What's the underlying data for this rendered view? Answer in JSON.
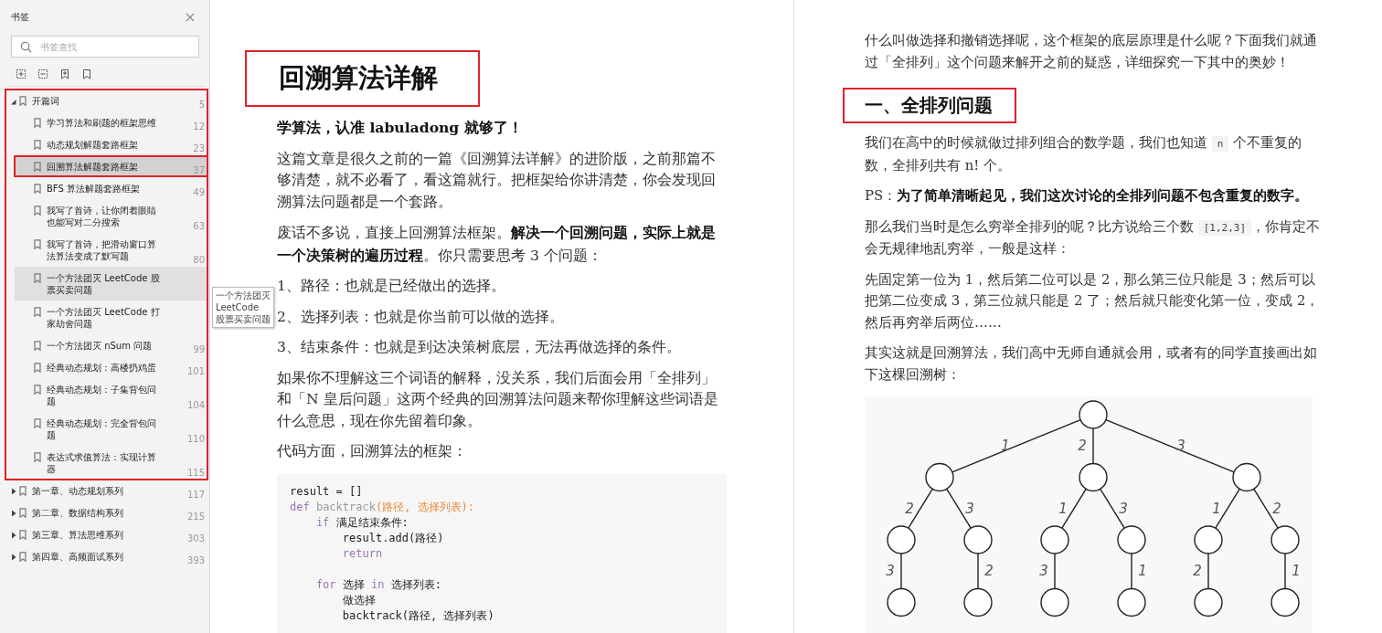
{
  "sidebar": {
    "title": "书签",
    "search": {
      "placeholder": "书签查找"
    },
    "items": [
      {
        "label": "开篇词",
        "page": "5",
        "expanded": true,
        "selected": false,
        "hovered": false,
        "annotated": true,
        "children": [
          {
            "label": "学习算法和刷题的框架思维",
            "page": "12",
            "selected": false,
            "hovered": false,
            "annotated": false
          },
          {
            "label": "动态规划解题套路框架",
            "page": "23",
            "selected": false,
            "hovered": false,
            "annotated": false
          },
          {
            "label": "回溯算法解题套路框架",
            "page": "37",
            "selected": true,
            "hovered": false,
            "annotated": true
          },
          {
            "label": "BFS 算法解题套路框架",
            "page": "49",
            "selected": false,
            "hovered": false,
            "annotated": false
          },
          {
            "label": "我写了首诗，让你闭着眼睛也能写对二分搜索",
            "page": "63",
            "selected": false,
            "hovered": false,
            "annotated": false
          },
          {
            "label": "我写了首诗，把滑动窗口算法算法变成了默写题",
            "page": "80",
            "selected": false,
            "hovered": false,
            "annotated": false
          },
          {
            "label": "一个方法团灭 LeetCode 股票买卖问题",
            "selected": false,
            "hovered": true,
            "annotated": false,
            "tooltip": "一个方法团灭 LeetCode 股票买卖问题"
          },
          {
            "label": "一个方法团灭 LeetCode 打家劫舍问题",
            "selected": false,
            "hovered": false,
            "annotated": false
          },
          {
            "label": "一个方法团灭 nSum 问题",
            "page": "99",
            "selected": false,
            "hovered": false,
            "annotated": false
          },
          {
            "label": "经典动态规划：高楼扔鸡蛋",
            "page": "101",
            "selected": false,
            "hovered": false,
            "annotated": false
          },
          {
            "label": "经典动态规划：子集背包问题",
            "page": "104",
            "selected": false,
            "hovered": false,
            "annotated": false
          },
          {
            "label": "经典动态规划：完全背包问题",
            "page": "110",
            "selected": false,
            "hovered": false,
            "annotated": false
          },
          {
            "label": "表达式求值算法：实现计算器",
            "page": "115",
            "selected": false,
            "hovered": false,
            "annotated": false
          }
        ]
      },
      {
        "label": "第一章、动态规划系列",
        "page": "117",
        "expanded": false,
        "selected": false,
        "hovered": false,
        "annotated": false
      },
      {
        "label": "第二章、数据结构系列",
        "page": "215",
        "expanded": false,
        "selected": false,
        "hovered": false,
        "annotated": false
      },
      {
        "label": "第三章、算法思维系列",
        "page": "303",
        "expanded": false,
        "selected": false,
        "hovered": false,
        "annotated": false
      },
      {
        "label": "第四章、高频面试系列",
        "page": "393",
        "expanded": false,
        "selected": false,
        "hovered": false,
        "annotated": false
      }
    ]
  },
  "pages": [
    {
      "blocks": [
        {
          "kind": "title",
          "text": "回溯算法详解",
          "annotated": true
        },
        {
          "kind": "paragraph",
          "segments": [
            {
              "kind": "bold",
              "text": "学算法，认准 labuladong 就够了！"
            }
          ]
        },
        {
          "kind": "paragraph",
          "segments": [
            {
              "kind": "text",
              "text": "这篇文章是很久之前的一篇《回溯算法详解》的进阶版，之前那篇不够清楚，就不必看了，看这篇就行。把框架给你讲清楚，你会发现回溯算法问题都是一个套路。"
            }
          ]
        },
        {
          "kind": "paragraph",
          "segments": [
            {
              "kind": "text",
              "text": "废话不多说，直接上回溯算法框架。"
            },
            {
              "kind": "bold",
              "text": "解决一个回溯问题，实际上就是一个决策树的遍历过程"
            },
            {
              "kind": "text",
              "text": "。你只需要思考 3 个问题："
            }
          ]
        },
        {
          "kind": "paragraph",
          "segments": [
            {
              "kind": "text",
              "text": "1、路径：也就是已经做出的选择。"
            }
          ]
        },
        {
          "kind": "paragraph",
          "segments": [
            {
              "kind": "text",
              "text": "2、选择列表：也就是你当前可以做的选择。"
            }
          ]
        },
        {
          "kind": "paragraph",
          "segments": [
            {
              "kind": "text",
              "text": "3、结束条件：也就是到达决策树底层，无法再做选择的条件。"
            }
          ]
        },
        {
          "kind": "paragraph",
          "segments": [
            {
              "kind": "text",
              "text": "如果你不理解这三个词语的解释，没关系，我们后面会用「全排列」和「N 皇后问题」这两个经典的回溯算法问题来帮你理解这些词语是什么意思，现在你先留着印象。"
            }
          ]
        },
        {
          "kind": "paragraph",
          "segments": [
            {
              "kind": "text",
              "text": "代码方面，回溯算法的框架："
            }
          ]
        },
        {
          "kind": "code",
          "lines": [
            {
              "kind": "code",
              "tokens": [
                {
                  "kind": "plain",
                  "text": "result = []"
                }
              ]
            },
            {
              "kind": "code",
              "tokens": [
                {
                  "kind": "keyword",
                  "text": "def"
                },
                {
                  "kind": "function",
                  "text": " backtrack"
                },
                {
                  "kind": "param",
                  "text": "(路径, 选择列表):"
                }
              ]
            },
            {
              "kind": "code",
              "tokens": [
                {
                  "kind": "keyword",
                  "text": "    if"
                },
                {
                  "kind": "plain",
                  "text": " 满足结束条件:"
                }
              ]
            },
            {
              "kind": "code",
              "tokens": [
                {
                  "kind": "plain",
                  "text": "        result.add(路径)"
                }
              ]
            },
            {
              "kind": "code",
              "tokens": [
                {
                  "kind": "keyword",
                  "text": "        return"
                }
              ]
            },
            {
              "kind": "blank"
            },
            {
              "kind": "code",
              "tokens": [
                {
                  "kind": "keyword",
                  "text": "    for"
                },
                {
                  "kind": "plain",
                  "text": " 选择 "
                },
                {
                  "kind": "keyword",
                  "text": "in"
                },
                {
                  "kind": "plain",
                  "text": " 选择列表:"
                }
              ]
            },
            {
              "kind": "code",
              "tokens": [
                {
                  "kind": "plain",
                  "text": "        做选择"
                }
              ]
            },
            {
              "kind": "code",
              "tokens": [
                {
                  "kind": "plain",
                  "text": "        backtrack(路径, 选择列表)"
                }
              ]
            }
          ]
        }
      ]
    },
    {
      "blocks": [
        {
          "kind": "paragraph",
          "segments": [
            {
              "kind": "text",
              "text": "什么叫做选择和撤销选择呢，这个框架的底层原理是什么呢？下面我们就通过「全排列」这个问题来解开之前的疑惑，详细探究一下其中的奥妙！"
            }
          ]
        },
        {
          "kind": "heading",
          "text": "一、全排列问题",
          "annotated": true
        },
        {
          "kind": "paragraph",
          "segments": [
            {
              "kind": "text",
              "text": "我们在高中的时候就做过排列组合的数学题，我们也知道 "
            },
            {
              "kind": "code",
              "text": "n"
            },
            {
              "kind": "text",
              "text": " 个不重复的数，全排列共有 n! 个。"
            }
          ]
        },
        {
          "kind": "paragraph",
          "segments": [
            {
              "kind": "text",
              "text": "PS："
            },
            {
              "kind": "bold",
              "text": "为了简单清晰起见，我们这次讨论的全排列问题不包含重复的数字。"
            }
          ]
        },
        {
          "kind": "paragraph",
          "segments": [
            {
              "kind": "text",
              "text": "那么我们当时是怎么穷举全排列的呢？比方说给三个数 "
            },
            {
              "kind": "code",
              "text": "[1,2,3]"
            },
            {
              "kind": "text",
              "text": "，你肯定不会无规律地乱穷举，一般是这样："
            }
          ]
        },
        {
          "kind": "paragraph",
          "segments": [
            {
              "kind": "text",
              "text": "先固定第一位为 1，然后第二位可以是 2，那么第三位只能是 3；然后可以把第二位变成 3，第三位就只能是 2 了；然后就只能变化第一位，变成 2，然后再穷举后两位……"
            }
          ]
        },
        {
          "kind": "paragraph",
          "segments": [
            {
              "kind": "text",
              "text": "其实这就是回溯算法，我们高中无师自通就会用，或者有的同学直接画出如下这棵回溯树："
            }
          ]
        },
        {
          "kind": "tree",
          "root": {
            "children": [
              {
                "edge": "1",
                "children": [
                  {
                    "edge": "2",
                    "children": [
                      {
                        "edge": "3"
                      }
                    ]
                  },
                  {
                    "edge": "3",
                    "children": [
                      {
                        "edge": "2"
                      }
                    ]
                  }
                ]
              },
              {
                "edge": "2",
                "children": [
                  {
                    "edge": "1",
                    "children": [
                      {
                        "edge": "3"
                      }
                    ]
                  },
                  {
                    "edge": "3",
                    "children": [
                      {
                        "edge": "1"
                      }
                    ]
                  }
                ]
              },
              {
                "edge": "3",
                "children": [
                  {
                    "edge": "1",
                    "children": [
                      {
                        "edge": "2"
                      }
                    ]
                  },
                  {
                    "edge": "2",
                    "children": [
                      {
                        "edge": "1"
                      }
                    ]
                  }
                ]
              }
            ]
          }
        }
      ]
    }
  ]
}
